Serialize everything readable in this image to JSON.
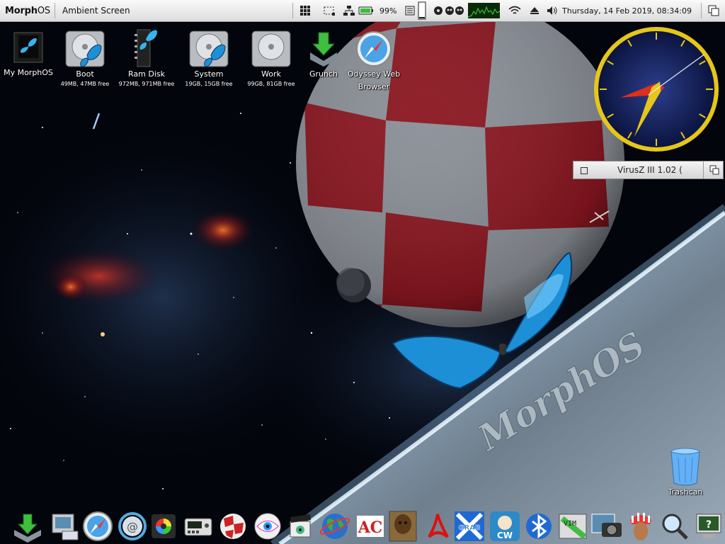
{
  "menubar": {
    "logo_prefix": "Morph",
    "logo_suffix": "OS",
    "screen_title": "Ambient Screen",
    "battery_percent": "99%",
    "datetime": "Thursday, 14 Feb 2019, 08:34:09"
  },
  "desktop_icons": [
    {
      "label": "My MorphOS",
      "sub": ""
    },
    {
      "label": "Boot",
      "sub": "49MB, 47MB free"
    },
    {
      "label": "Ram Disk",
      "sub": "972MB, 971MB free"
    },
    {
      "label": "System",
      "sub": "19GB, 15GB free"
    },
    {
      "label": "Work",
      "sub": "99GB, 81GB free"
    },
    {
      "label": "Grunch",
      "sub": ""
    },
    {
      "label": "Odyssey Web",
      "sub": "Browser"
    }
  ],
  "trashcan": {
    "label": "Trashcan"
  },
  "virusz_window": {
    "title": "VirusZ III 1.02 ("
  },
  "clock": {
    "hour": 8,
    "minute": 34,
    "second": 9
  },
  "wallpaper": {
    "text": "MorphOS"
  },
  "colors": {
    "accent_yellow": "#e6c619",
    "clock_face": "#1a2a6a",
    "balloon_red": "#8a1620",
    "butterfly_blue": "#1d8fd6"
  },
  "dock": {
    "items": [
      "download-icon",
      "finder-icon",
      "compass-icon",
      "email-icon",
      "color-wheel-icon",
      "radio-icon",
      "ball-icon",
      "eye-icon",
      "clapper-icon",
      "globe-icon",
      "apps-icon",
      "pdf-icon",
      "grab-icon",
      "cupcake-icon",
      "bluetooth-icon",
      "terminal-icon",
      "camera-icon",
      "chief-icon",
      "search-icon",
      "help-icon"
    ]
  }
}
